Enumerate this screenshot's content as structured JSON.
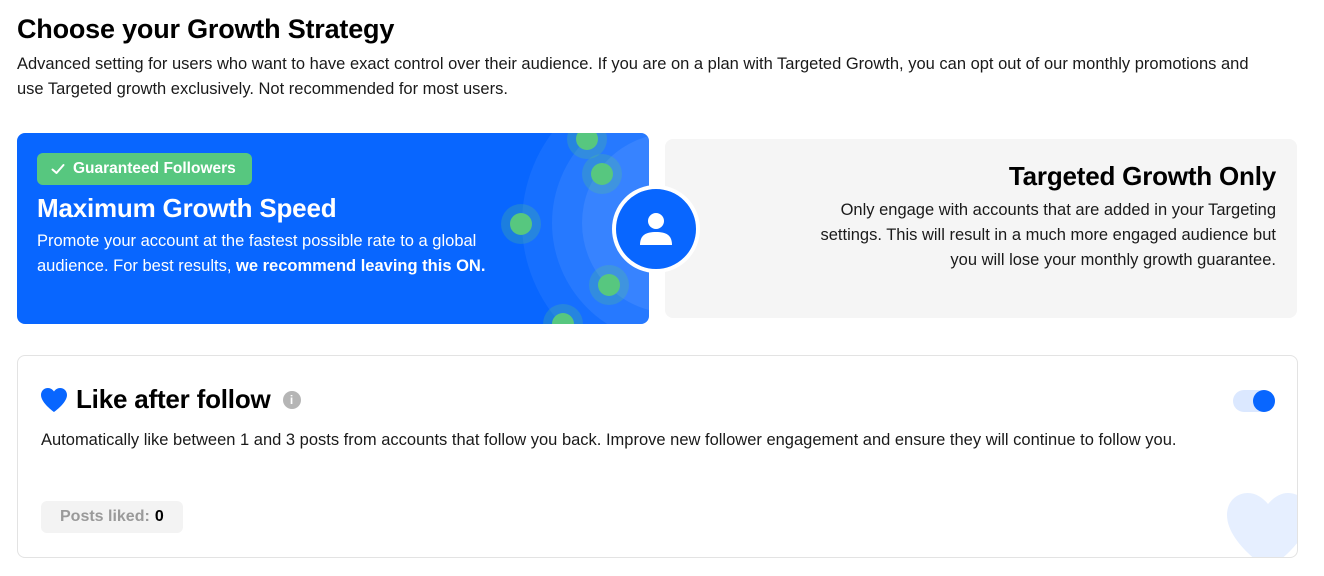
{
  "page": {
    "title": "Choose your Growth Strategy",
    "description": "Advanced setting for users who want to have exact control over their audience. If you are on a plan with Targeted Growth, you can opt out of our monthly promotions and use Targeted growth exclusively. Not recommended for most users."
  },
  "strategies": {
    "maximum": {
      "badge": "Guaranteed Followers",
      "title": "Maximum Growth Speed",
      "description_plain": "Promote your account at the fastest possible rate to a global audience. For best results, ",
      "description_bold": "we recommend leaving this ON.",
      "selected": true
    },
    "targeted": {
      "title": "Targeted Growth Only",
      "description": "Only engage with accounts that are added in your Targeting settings. This will result in a much more engaged audience but you will lose your monthly growth guarantee.",
      "selected": false
    },
    "switch_icon": "user-icon"
  },
  "like_after_follow": {
    "title": "Like after follow",
    "icon": "heart-icon",
    "info_icon": "i",
    "enabled": true,
    "description": "Automatically like between 1 and 3 posts from accounts that follow you back. Improve new follower engagement and ensure they will continue to follow you.",
    "posts_liked_label": "Posts liked:",
    "posts_liked_count": "0"
  },
  "colors": {
    "primary": "#0866ff",
    "badge_green": "#57c77f",
    "card_grey": "#f5f5f5"
  }
}
